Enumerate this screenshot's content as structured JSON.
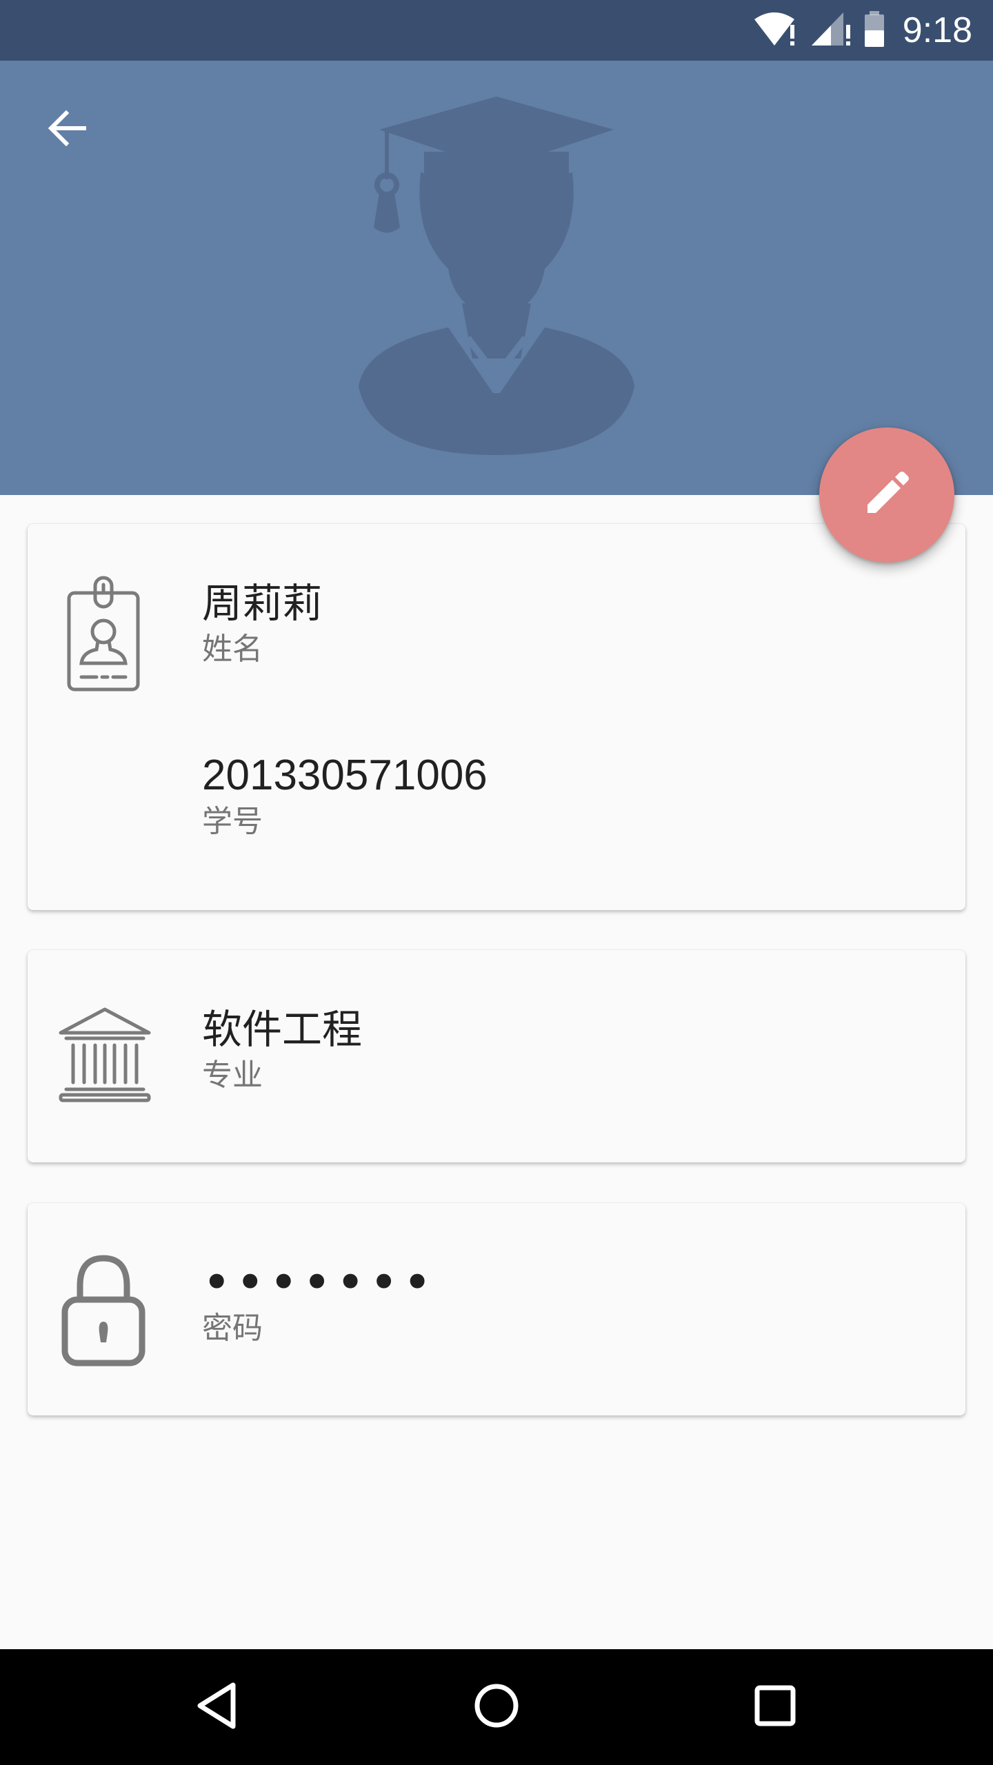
{
  "status_bar": {
    "time": "9:18",
    "icons": [
      "wifi-alert-icon",
      "signal-alert-icon",
      "battery-icon"
    ]
  },
  "header": {
    "back_icon": "arrow-left-icon",
    "avatar_icon": "graduate-silhouette-icon",
    "color": "#627fa5"
  },
  "fab": {
    "icon": "pencil-icon",
    "color": "#e28785"
  },
  "profile": {
    "name": {
      "value": "周莉莉",
      "label": "姓名",
      "icon": "id-badge-icon"
    },
    "student_id": {
      "value": "201330571006",
      "label": "学号"
    },
    "major": {
      "value": "软件工程",
      "label": "专业",
      "icon": "institution-icon"
    },
    "password": {
      "value": "•••••••",
      "label": "密码",
      "icon": "lock-icon"
    }
  },
  "nav_bar": {
    "back": "triangle-back-icon",
    "home": "circle-home-icon",
    "recents": "square-recents-icon"
  }
}
